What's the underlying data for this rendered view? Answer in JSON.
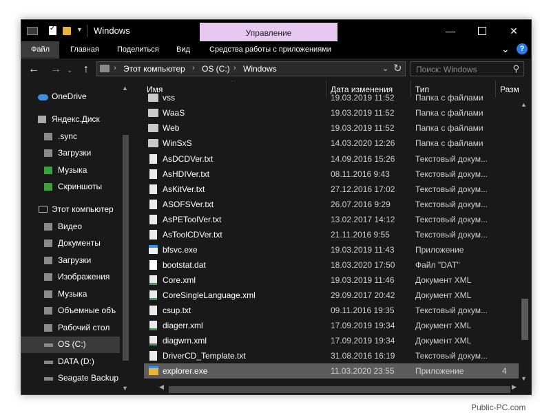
{
  "window": {
    "title": "Windows",
    "manage_label": "Управление",
    "minimize_symbol": "—",
    "close_symbol": "✕"
  },
  "ribbon": {
    "tabs": [
      "Файл",
      "Главная",
      "Поделиться",
      "Вид"
    ],
    "context_tab": "Средства работы с приложениями",
    "expand_symbol": "⌄",
    "help_symbol": "?"
  },
  "address": {
    "crumbs": [
      "Этот компьютер",
      "OS (C:)",
      "Windows"
    ],
    "search_placeholder": "Поиск: Windows",
    "back_symbol": "←",
    "forward_symbol": "→",
    "up_symbol": "↑"
  },
  "sidebar": {
    "items": [
      {
        "label": "OneDrive",
        "icon": "onedrive-icon"
      },
      {
        "label": "Яндекс.Диск",
        "icon": "yandex-disk-icon"
      },
      {
        "label": ".sync",
        "icon": "folder-icon"
      },
      {
        "label": "Загрузки",
        "icon": "folder-icon"
      },
      {
        "label": "Музыка",
        "icon": "synced-folder-icon"
      },
      {
        "label": "Скриншоты",
        "icon": "synced-folder-icon"
      },
      {
        "label": "Этот компьютер",
        "icon": "computer-icon"
      },
      {
        "label": "Видео",
        "icon": "videos-icon"
      },
      {
        "label": "Документы",
        "icon": "documents-icon"
      },
      {
        "label": "Загрузки",
        "icon": "downloads-icon"
      },
      {
        "label": "Изображения",
        "icon": "pictures-icon"
      },
      {
        "label": "Музыка",
        "icon": "music-icon"
      },
      {
        "label": "Объемные объ",
        "icon": "3d-objects-icon"
      },
      {
        "label": "Рабочий стол",
        "icon": "desktop-icon"
      },
      {
        "label": "OS (C:)",
        "icon": "windows-drive-icon"
      },
      {
        "label": "DATA (D:)",
        "icon": "drive-icon"
      },
      {
        "label": "Seagate Backup",
        "icon": "drive-icon"
      }
    ]
  },
  "columns": {
    "name": "Имя",
    "date": "Дата изменения",
    "type": "Тип",
    "size": "Разм"
  },
  "files": [
    {
      "name": "vss",
      "date": "19.03.2019 11:52",
      "type": "Папка с файлами",
      "size": "",
      "icon": "folder-icon"
    },
    {
      "name": "WaaS",
      "date": "19.03.2019 11:52",
      "type": "Папка с файлами",
      "size": "",
      "icon": "folder-icon"
    },
    {
      "name": "Web",
      "date": "19.03.2019 11:52",
      "type": "Папка с файлами",
      "size": "",
      "icon": "folder-icon"
    },
    {
      "name": "WinSxS",
      "date": "14.03.2020 12:26",
      "type": "Папка с файлами",
      "size": "",
      "icon": "folder-icon"
    },
    {
      "name": "AsDCDVer.txt",
      "date": "14.09.2016 15:26",
      "type": "Текстовый докум...",
      "size": "",
      "icon": "text-file-icon"
    },
    {
      "name": "AsHDIVer.txt",
      "date": "08.11.2016 9:43",
      "type": "Текстовый докум...",
      "size": "",
      "icon": "text-file-icon"
    },
    {
      "name": "AsKitVer.txt",
      "date": "27.12.2016 17:02",
      "type": "Текстовый докум...",
      "size": "",
      "icon": "text-file-icon"
    },
    {
      "name": "ASOFSVer.txt",
      "date": "26.07.2016 9:29",
      "type": "Текстовый докум...",
      "size": "",
      "icon": "text-file-icon"
    },
    {
      "name": "AsPEToolVer.txt",
      "date": "13.02.2017 14:12",
      "type": "Текстовый докум...",
      "size": "",
      "icon": "text-file-icon"
    },
    {
      "name": "AsToolCDVer.txt",
      "date": "21.11.2016 9:55",
      "type": "Текстовый докум...",
      "size": "",
      "icon": "text-file-icon"
    },
    {
      "name": "bfsvc.exe",
      "date": "19.03.2019 11:43",
      "type": "Приложение",
      "size": "",
      "icon": "application-icon"
    },
    {
      "name": "bootstat.dat",
      "date": "18.03.2020 17:50",
      "type": "Файл \"DAT\"",
      "size": "",
      "icon": "dat-file-icon"
    },
    {
      "name": "Core.xml",
      "date": "19.03.2019 11:46",
      "type": "Документ XML",
      "size": "",
      "icon": "xml-file-icon"
    },
    {
      "name": "CoreSingleLanguage.xml",
      "date": "29.09.2017 20:42",
      "type": "Документ XML",
      "size": "",
      "icon": "xml-file-icon"
    },
    {
      "name": "csup.txt",
      "date": "09.11.2016 19:35",
      "type": "Текстовый докум...",
      "size": "",
      "icon": "text-file-icon"
    },
    {
      "name": "diagerr.xml",
      "date": "17.09.2019 19:34",
      "type": "Документ XML",
      "size": "",
      "icon": "xml-file-icon"
    },
    {
      "name": "diagwrn.xml",
      "date": "17.09.2019 19:34",
      "type": "Документ XML",
      "size": "",
      "icon": "xml-file-icon"
    },
    {
      "name": "DriverCD_Template.txt",
      "date": "31.08.2016 16:19",
      "type": "Текстовый докум...",
      "size": "",
      "icon": "text-file-icon"
    },
    {
      "name": "explorer.exe",
      "date": "11.03.2020 23:55",
      "type": "Приложение",
      "size": "4",
      "icon": "explorer-icon",
      "selected": true
    }
  ],
  "watermark": "Public-PC.com"
}
